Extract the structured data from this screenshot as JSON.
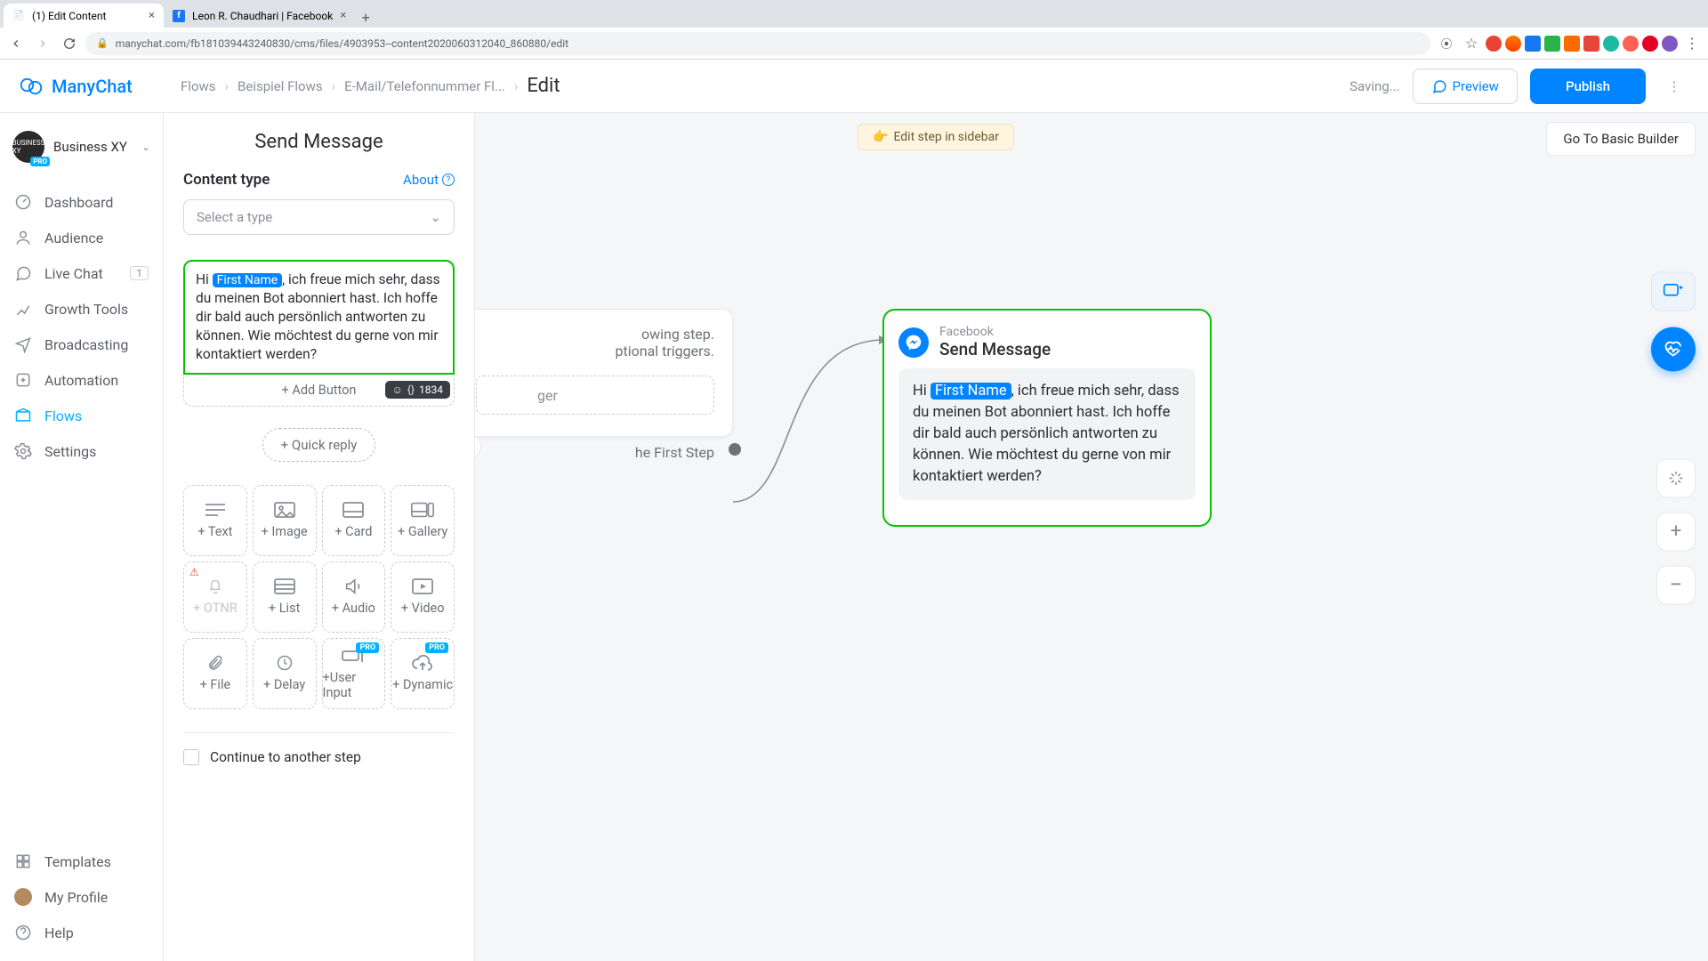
{
  "browser": {
    "tabs": [
      {
        "title": "(1) Edit Content",
        "active": true
      },
      {
        "title": "Leon R. Chaudhari | Facebook",
        "active": false
      }
    ],
    "url": "manychat.com/fb181039443240830/cms/files/4903953--content2020060312040_860880/edit"
  },
  "app": {
    "brand": "ManyChat",
    "breadcrumbs": [
      "Flows",
      "Beispiel Flows",
      "E-Mail/Telefonnummer Fl..."
    ],
    "edit_label": "Edit",
    "saving": "Saving...",
    "preview_label": "Preview",
    "publish_label": "Publish"
  },
  "account": {
    "name": "Business XY",
    "badge": "PRO"
  },
  "sidebar": {
    "items": [
      {
        "label": "Dashboard"
      },
      {
        "label": "Audience"
      },
      {
        "label": "Live Chat",
        "badge": "1"
      },
      {
        "label": "Growth Tools"
      },
      {
        "label": "Broadcasting"
      },
      {
        "label": "Automation"
      },
      {
        "label": "Flows",
        "active": true
      },
      {
        "label": "Settings"
      }
    ],
    "bottom": [
      {
        "label": "Templates"
      },
      {
        "label": "My Profile"
      },
      {
        "label": "Help"
      }
    ]
  },
  "canvas": {
    "edit_step": "Edit step in sidebar",
    "basic_builder": "Go To Basic Builder",
    "ghost": {
      "line1_tail": "owing step.",
      "line2_tail": "ptional triggers.",
      "trigger_tail": "ger",
      "first_step": "he First Step"
    }
  },
  "editor": {
    "title": "Send Message",
    "content_type_label": "Content type",
    "about_label": "About",
    "select_placeholder": "Select a type",
    "message": {
      "prefix": "Hi ",
      "chip": "First Name",
      "suffix": ", ich freue mich sehr, dass du meinen Bot abonniert hast. Ich hoffe dir bald auch persönlich antworten zu können. Wie möchtest du gerne von mir kontaktiert werden?"
    },
    "add_button": "+ Add Button",
    "char_count": "1834",
    "quick_reply": "+ Quick reply",
    "blocks": [
      "+ Text",
      "+ Image",
      "+ Card",
      "+ Gallery",
      "+ OTNR",
      "+ List",
      "+ Audio",
      "+ Video",
      "+ File",
      "+ Delay",
      "+User Input",
      "+ Dynamic"
    ],
    "continue": "Continue to another step"
  },
  "node": {
    "platform": "Facebook",
    "title": "Send Message",
    "prefix": "Hi ",
    "chip": "First Name",
    "suffix": ", ich freue mich sehr, dass du meinen Bot abonniert hast. Ich hoffe dir bald auch persönlich antworten zu können. Wie möchtest du gerne von mir kontaktiert werden?"
  }
}
